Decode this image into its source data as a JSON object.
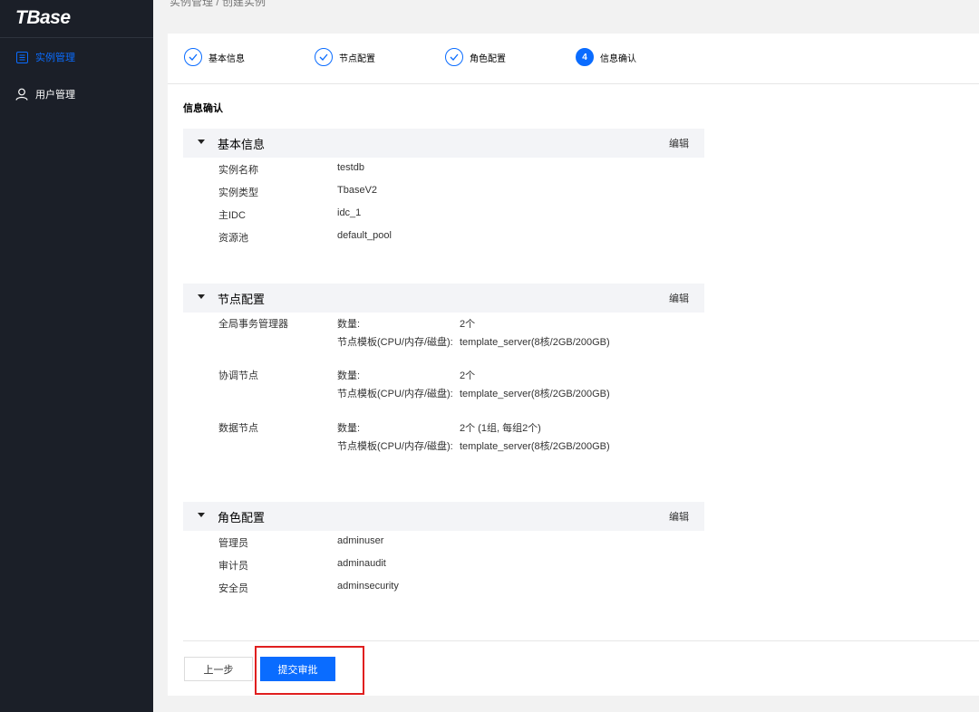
{
  "app": {
    "logo": "TBase"
  },
  "sidebar": {
    "items": [
      {
        "label": "实例管理",
        "icon": "list-icon",
        "active": true
      },
      {
        "label": "用户管理",
        "icon": "user-icon",
        "active": false
      }
    ]
  },
  "breadcrumb": "实例管理 / 创建实例",
  "steps": [
    {
      "label": "基本信息",
      "state": "done"
    },
    {
      "label": "节点配置",
      "state": "done"
    },
    {
      "label": "角色配置",
      "state": "done"
    },
    {
      "label": "信息确认",
      "state": "active",
      "number": "4"
    }
  ],
  "page_title": "信息确认",
  "edit_label": "编辑",
  "basic": {
    "title": "基本信息",
    "rows": [
      {
        "label": "实例名称",
        "value": "testdb"
      },
      {
        "label": "实例类型",
        "value": "TbaseV2"
      },
      {
        "label": "主IDC",
        "value": "idc_1"
      },
      {
        "label": "资源池",
        "value": "default_pool"
      }
    ]
  },
  "nodes": {
    "title": "节点配置",
    "count_label": "数量:",
    "template_label": "节点模板(CPU/内存/磁盘):",
    "groups": [
      {
        "name": "全局事务管理器",
        "count": "2个",
        "template": "template_server(8核/2GB/200GB)"
      },
      {
        "name": "协调节点",
        "count": "2个",
        "template": "template_server(8核/2GB/200GB)"
      },
      {
        "name": "数据节点",
        "count": "2个 (1组, 每组2个)",
        "template": "template_server(8核/2GB/200GB)"
      }
    ]
  },
  "roles": {
    "title": "角色配置",
    "rows": [
      {
        "label": "管理员",
        "value": "adminuser"
      },
      {
        "label": "审计员",
        "value": "adminaudit"
      },
      {
        "label": "安全员",
        "value": "adminsecurity"
      }
    ]
  },
  "buttons": {
    "prev": "上一步",
    "submit": "提交审批"
  },
  "colors": {
    "accent": "#0a6cff",
    "sidebar": "#1b1f28",
    "highlight": "#e01f1f"
  }
}
